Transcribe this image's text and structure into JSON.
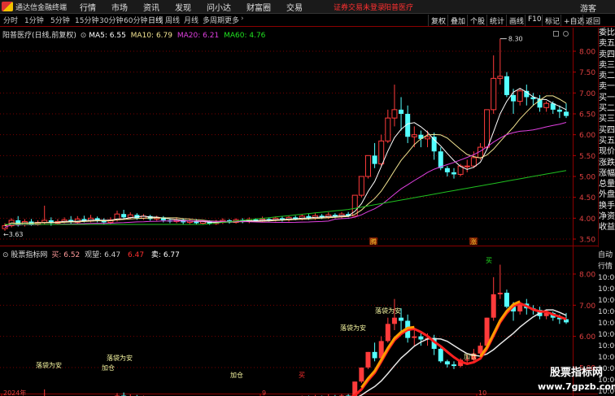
{
  "titlebar": {
    "app_title": "通达信金融终端",
    "menu": [
      "行情",
      "市场",
      "资讯",
      "发现",
      "问小达",
      "财富圈",
      "交易"
    ],
    "login_status": "证券交易未登录",
    "stock_title": "阳普医疗",
    "guest_label": "游客"
  },
  "periodbar": {
    "periods": [
      "分时",
      "1分钟",
      "5分钟",
      "15分钟",
      "30分钟",
      "60分钟",
      "日线",
      "周线",
      "月线",
      "多周期",
      "更多"
    ],
    "active": "日线",
    "tools": [
      "复权",
      "叠加",
      "个股",
      "统计",
      "画线",
      "F10",
      "标记",
      "+自选",
      "返回"
    ]
  },
  "main_legend": {
    "stock": "阳普医疗(日线,前复权)",
    "ma5_label": "MA5:",
    "ma5": "6.55",
    "ma10_label": "MA10:",
    "ma10": "6.79",
    "ma20_label": "MA20:",
    "ma20": "6.21",
    "ma60_label": "MA60:",
    "ma60": "4.76"
  },
  "sub_legend": {
    "name": "股票指标网",
    "buy_label": "买:",
    "buy": "6.52",
    "watch_label": "观望:",
    "watch": "6.47",
    "sell_label": "卖:",
    "sell": "6.77",
    "extra": "6.47"
  },
  "stat_column": [
    "委比",
    "卖五",
    "卖四",
    "卖三",
    "卖二",
    "卖一",
    "买一",
    "买二",
    "买三",
    "买四",
    "买五",
    "现价",
    "涨跌",
    "涨幅",
    "总量",
    "外盘",
    "换手",
    "净资",
    "收益"
  ],
  "time_column": [
    "自动",
    "行情",
    "10:00",
    "10:00",
    "10:00",
    "10:00",
    "10:00",
    "10:00",
    "10:00",
    "10:00",
    "10:00",
    "10:00",
    "10:00"
  ],
  "price_axis": [
    "8.00",
    "7.50",
    "7.00",
    "6.50",
    "6.00",
    "5.50",
    "5.00",
    "4.50",
    "4.00",
    "3.50"
  ],
  "sub_axis": [
    "8.00",
    "7.00",
    "6.00",
    "5.00"
  ],
  "annotations": {
    "high_price": "8.30",
    "low_price": "3.63",
    "marker_teng": "腾",
    "marker_zhang": "涨",
    "label_luodai": "落袋为安",
    "label_jiacang": "加仓",
    "label_mai": "买"
  },
  "date_axis": [
    "2024年",
    "9",
    "10"
  ],
  "watermark": {
    "title": "股票指标网",
    "url": "www.7gpzb.com"
  },
  "colors": {
    "up": "#ff3b3b",
    "down": "#54ffff",
    "ma5": "#ffffff",
    "ma10": "#f2e391",
    "ma20": "#e040e0",
    "ma60": "#20c020",
    "orange": "#ff9a00",
    "grid": "#7a0000"
  }
}
